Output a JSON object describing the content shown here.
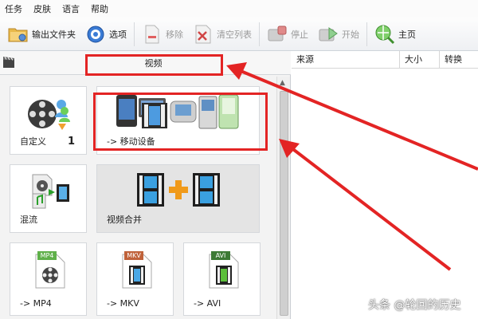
{
  "menu": [
    "任务",
    "皮肤",
    "语言",
    "帮助"
  ],
  "toolbar": {
    "output_folder": "输出文件夹",
    "options": "选项",
    "remove": "移除",
    "clear_list": "清空列表",
    "stop": "停止",
    "start": "开始",
    "home": "主页"
  },
  "left_panel": {
    "category_title": "视频",
    "tiles": {
      "custom": "自定义",
      "custom_count": "1",
      "mobile": "-> 移动设备",
      "mux": "混流",
      "merge": "视频合并",
      "mp4": "-> MP4",
      "mp4_badge": "MP4",
      "mkv": "-> MKV",
      "mkv_badge": "MKV",
      "avi": "-> AVI",
      "avi_badge": "AVI"
    }
  },
  "right_panel": {
    "columns": [
      "来源",
      "大小",
      "转换"
    ]
  },
  "watermark": "头条 @轮回的历史",
  "colors": {
    "annotation_red": "#e32424"
  }
}
